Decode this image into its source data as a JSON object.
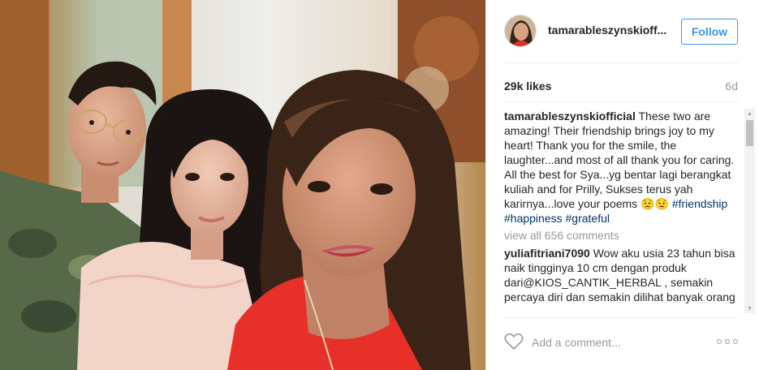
{
  "post": {
    "username": "tamarableszynskioff...",
    "follow_label": "Follow",
    "likes": "29k likes",
    "age": "6d"
  },
  "caption": {
    "author": "tamarableszynskiofficial",
    "text": " These two are amazing! Their friendship brings joy to my heart! Thank you for the smile, the laughter...and most of all thank you for caring. All the best for Sya...yg bentar lagi berangkat kuliah and for Prilly, Sukses terus yah karirnya...love your poems 😟😟 ",
    "tag1": "#friendship",
    "tag2": "#happiness",
    "tag3": "#grateful"
  },
  "view_all": "view all 656 comments",
  "comment1": {
    "author": "yuliafitriani7090",
    "text": " Wow aku usia 23 tahun bisa naik tingginya 10 cm dengan produk dari@KIOS_CANTIK_HERBAL , semakin percaya diri dan semakin dilihat banyak orang"
  },
  "add_comment_placeholder": "Add a comment...",
  "icons": {
    "like": "heart-icon",
    "options": "more-options-icon",
    "scroll_up": "scroll-up-arrow-icon",
    "scroll_down": "scroll-down-arrow-icon"
  },
  "colors": {
    "accent": "#3897f0",
    "hashtag": "#003569",
    "muted": "#999999"
  }
}
